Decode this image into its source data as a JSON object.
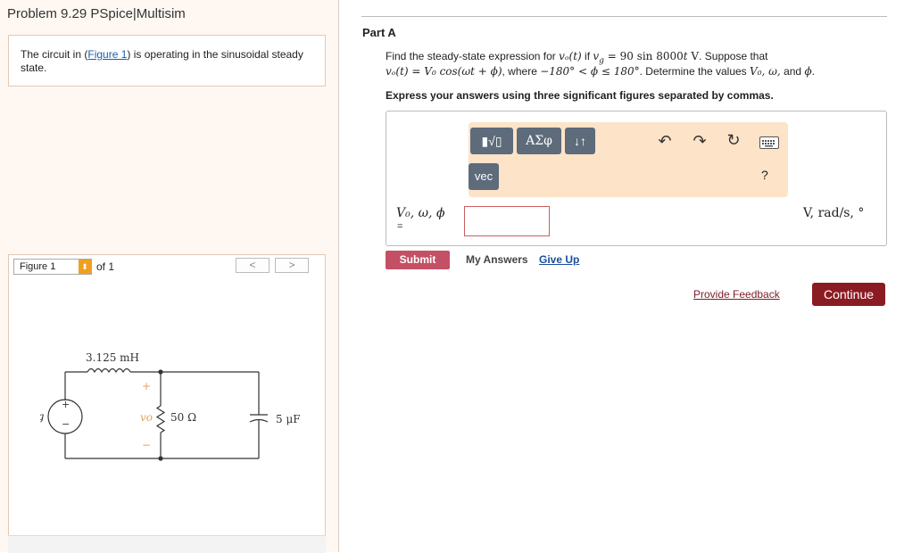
{
  "problem_title": "Problem 9.29 PSpice|Multisim",
  "intro": {
    "prefix": "The circuit in (",
    "link": "Figure 1",
    "suffix": ") is operating in the sinusoidal steady state."
  },
  "figure_nav": {
    "selected": "Figure 1",
    "of_text": "of 1",
    "prev_glyph": "<",
    "next_glyph": ">"
  },
  "circuit": {
    "inductor_label": "3.125 mH",
    "resistor_label": "50 Ω",
    "capacitor_label": "5 μF",
    "source_label": "vg",
    "output_label": "vo",
    "plus_sign": "+",
    "minus_sign": "−"
  },
  "part": {
    "label": "Part A",
    "q1_a": "Find the steady-state expression for ",
    "q1_vo": "vₒ(t)",
    "q1_b": " if ",
    "q1_vg": "v",
    "q1_vg_sub": "g",
    "q1_c": " = 90 sin 8000",
    "q1_t": "t",
    "q1_d": " V",
    "q1_e": ". Suppose that",
    "q2_a": "vₒ(t)",
    "q2_b": " = V₀ cos(ωt + ϕ)",
    "q2_c": ", where ",
    "q2_d": "−180° < ϕ ≤ 180°",
    "q2_e": ". Determine the values ",
    "q2_f": "V₀, ω,",
    "q2_g": " and ",
    "q2_h": "ϕ",
    "q2_i": ".",
    "instruction": "Express your answers using three significant figures separated by commas."
  },
  "toolbar": {
    "templates_label": "▮√▯",
    "greek_label": "ΑΣφ",
    "arrows_label": "↓↑",
    "vec_label": "vec",
    "undo_glyph": "↶",
    "redo_glyph": "↷",
    "reset_glyph": "↻",
    "help_label": "?"
  },
  "answer": {
    "variables": "V₀, ω, ϕ",
    "equals": "=",
    "value": "",
    "units": "V, rad/s, °"
  },
  "actions": {
    "submit": "Submit",
    "my_answers": "My Answers",
    "give_up": "Give Up",
    "feedback": "Provide Feedback",
    "continue": "Continue"
  },
  "colors": {
    "submit": "#c45065",
    "continue": "#8b1b23",
    "toolbar_bg": "#fde3c8",
    "link": "#1a5fa8"
  }
}
